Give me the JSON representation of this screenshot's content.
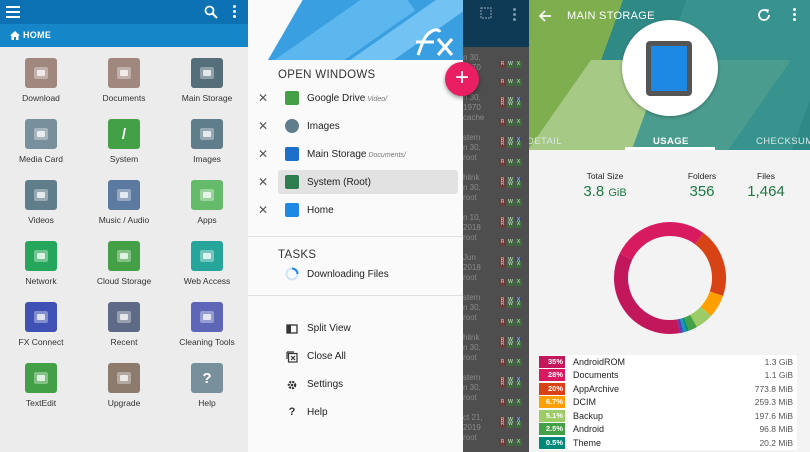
{
  "panel1": {
    "breadcrumb": "Home",
    "grid": [
      {
        "label": "Download",
        "icon": "download-icon",
        "color": "#a1887f"
      },
      {
        "label": "Documents",
        "icon": "documents-icon",
        "color": "#a1887f"
      },
      {
        "label": "Main Storage",
        "icon": "main-storage-icon",
        "color": "#546e7a"
      },
      {
        "label": "Media Card",
        "icon": "media-card-icon",
        "color": "#78909c"
      },
      {
        "label": "System",
        "icon": "system-icon",
        "color": "#43a047",
        "glyph": "/"
      },
      {
        "label": "Images",
        "icon": "images-icon",
        "color": "#607d8b"
      },
      {
        "label": "Videos",
        "icon": "videos-icon",
        "color": "#607d8b"
      },
      {
        "label": "Music / Audio",
        "icon": "music-audio-icon",
        "color": "#5c7aa0"
      },
      {
        "label": "Apps",
        "icon": "apps-icon",
        "color": "#66bb6a"
      },
      {
        "label": "Network",
        "icon": "network-icon",
        "color": "#26a65b"
      },
      {
        "label": "Cloud Storage",
        "icon": "cloud-storage-icon",
        "color": "#43a047"
      },
      {
        "label": "Web Access",
        "icon": "web-access-icon",
        "color": "#26a69a"
      },
      {
        "label": "FX Connect",
        "icon": "fx-connect-icon",
        "color": "#3f51b5"
      },
      {
        "label": "Recent",
        "icon": "recent-icon",
        "color": "#5f6b86"
      },
      {
        "label": "Cleaning Tools",
        "icon": "cleaning-tools-icon",
        "color": "#5e66b8"
      },
      {
        "label": "TextEdit",
        "icon": "textedit-icon",
        "color": "#43a047"
      },
      {
        "label": "Upgrade",
        "icon": "upgrade-icon",
        "color": "#8d7b6e"
      },
      {
        "label": "Help",
        "icon": "help-icon",
        "color": "#78909c",
        "glyph": "?"
      }
    ]
  },
  "panel2": {
    "open_windows_heading": "OPEN WINDOWS",
    "windows": [
      {
        "label": "Google Drive",
        "sub": "Video/",
        "icon": "google-drive-icon",
        "color": "#43a047"
      },
      {
        "label": "Images",
        "sub": "",
        "icon": "images-icon",
        "color": "#607d8b"
      },
      {
        "label": "Main Storage",
        "sub": "Documents/",
        "icon": "main-storage-icon",
        "color": "#1e6fc9"
      },
      {
        "label": "System (Root)",
        "sub": "",
        "icon": "system-root-icon",
        "color": "#2e7d4f",
        "active": true
      },
      {
        "label": "Home",
        "sub": "",
        "icon": "home-icon",
        "color": "#1e88e5"
      }
    ],
    "tasks_heading": "TASKS",
    "task": "Downloading Files",
    "menu": [
      {
        "label": "Split View",
        "icon": "split-view-icon"
      },
      {
        "label": "Close All",
        "icon": "close-all-icon"
      },
      {
        "label": "Settings",
        "icon": "settings-icon"
      },
      {
        "label": "Help",
        "icon": "help-icon"
      }
    ]
  },
  "strip": {
    "rows": [
      [
        "n 30,",
        "1970",
        "root"
      ],
      [
        "n 30,",
        "1970",
        "cache"
      ],
      [
        "stem",
        "n 30,",
        "root"
      ],
      [
        "hlink",
        "n 30,",
        "root"
      ],
      [
        "n 10,",
        "2018",
        "root"
      ],
      [
        "Jun",
        "2018",
        "root"
      ],
      [
        "stem",
        "n 30,",
        "root"
      ],
      [
        "hlink",
        "n 30,",
        "root"
      ],
      [
        "stem",
        "n 30,",
        "root"
      ],
      [
        "ct 21,",
        "2019",
        "root"
      ]
    ]
  },
  "panel3": {
    "title": "Main Storage",
    "tabs": [
      "DETAIL",
      "USAGE",
      "CHECKSUM"
    ],
    "active_tab": "USAGE",
    "stats": [
      {
        "label": "Total Size",
        "value": "3.8",
        "unit": "GiB"
      },
      {
        "label": "Folders",
        "value": "356",
        "unit": ""
      },
      {
        "label": "Files",
        "value": "1,464",
        "unit": ""
      }
    ],
    "usage": [
      {
        "pct": "35%",
        "name": "AndroidROM",
        "size": "1.3 GiB",
        "color": "#c2185b",
        "value": 35
      },
      {
        "pct": "28%",
        "name": "Documents",
        "size": "1.1 GiB",
        "color": "#d81b60",
        "value": 28
      },
      {
        "pct": "20%",
        "name": "AppArchive",
        "size": "773.8 MiB",
        "color": "#d84315",
        "value": 20
      },
      {
        "pct": "6.7%",
        "name": "DCIM",
        "size": "259.3 MiB",
        "color": "#ffa000",
        "value": 6.7
      },
      {
        "pct": "5.1%",
        "name": "Backup",
        "size": "197.6 MiB",
        "color": "#9ccc65",
        "value": 5.1
      },
      {
        "pct": "2.5%",
        "name": "Android",
        "size": "96.8 MiB",
        "color": "#43a047",
        "value": 2.5
      },
      {
        "pct": "0.5%",
        "name": "Theme",
        "size": "20.2 MiB",
        "color": "#00897b",
        "value": 0.5
      }
    ],
    "donut_tail_colors": [
      "#00897b",
      "#0097a7",
      "#0288d1",
      "#1976d2",
      "#303f9f",
      "#512da8",
      "#7b1fa2"
    ]
  }
}
